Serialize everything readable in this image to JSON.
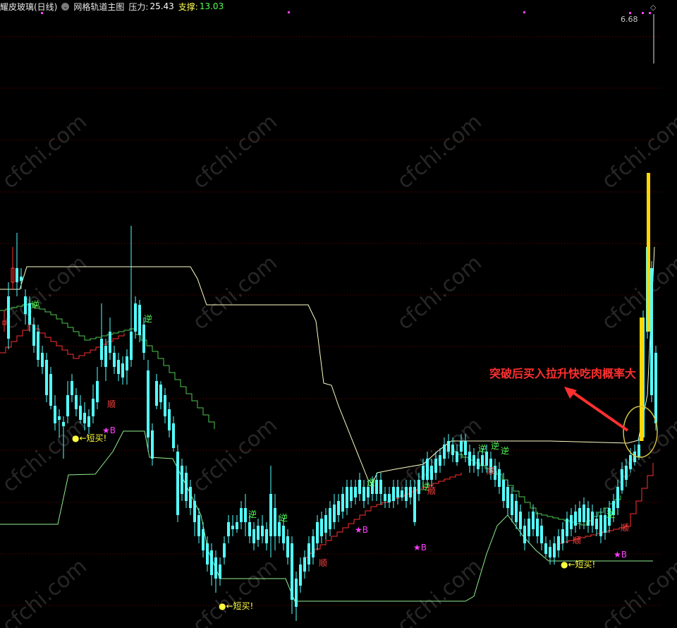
{
  "header": {
    "stock_name": "耀皮玻璃(日线)",
    "indicator_name": "网格轨道主图",
    "resistance_label": "压力:",
    "resistance_value": "25.43",
    "support_label": "支撑:",
    "support_value": "13.03"
  },
  "top_right": {
    "diamond_icon": "diamond-icon"
  },
  "watermark_text": "cfchi.com",
  "colors": {
    "up": "#ff3232",
    "down": "#54ffff",
    "upper_rail": "#ffffc8",
    "lower_rail": "#90ee90",
    "step_red": "#ff3030",
    "step_green": "#50c850",
    "highlight": "#ffd700",
    "grid": "#7a0000",
    "label_ni": "#54ff54",
    "label_shun": "#ff4040",
    "label_buy": "#ffff40",
    "label_star": "#ff40ff",
    "annotation": "#ff3030"
  },
  "chart_data": {
    "type": "candlestick",
    "price_label": "6.68",
    "annotation": "突破后买入拉升快吃肉概率大",
    "markers": [
      {
        "text": "逆",
        "at_candle": 8
      },
      {
        "text": "逆",
        "at_candle": 30
      },
      {
        "text": "顺",
        "at_candle": 22
      },
      {
        "text": "●←短买!",
        "at_candle": 15
      },
      {
        "text": "★B",
        "at_candle": 22
      },
      {
        "text": "逆",
        "at_candle": 54
      },
      {
        "text": "逆",
        "at_candle": 59
      },
      {
        "text": "●←短买!",
        "at_candle": 47
      },
      {
        "text": "顺",
        "at_candle": 67
      },
      {
        "text": "★B",
        "at_candle": 75
      },
      {
        "text": "逆",
        "at_candle": 88
      },
      {
        "text": "★B",
        "at_candle": 88
      },
      {
        "text": "顺",
        "at_candle": 89
      },
      {
        "text": "逆",
        "at_candle": 100
      },
      {
        "text": "逆",
        "at_candle": 104
      },
      {
        "text": "顺",
        "at_candle": 101
      },
      {
        "text": "逆",
        "at_candle": 106
      },
      {
        "text": "顺",
        "at_candle": 104
      },
      {
        "text": "顺",
        "at_candle": 122
      },
      {
        "text": "逆",
        "at_candle": 126
      },
      {
        "text": "●←短买!",
        "at_candle": 116
      },
      {
        "text": "★B",
        "at_candle": 126
      }
    ]
  }
}
